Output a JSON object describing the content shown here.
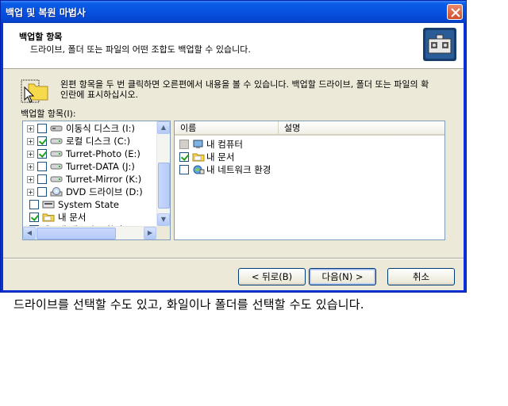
{
  "window": {
    "title": "백업 및 복원 마법사"
  },
  "header": {
    "title": "백업할 항목",
    "subtitle": "드라이브, 폴더 또는 파일의 어떤 조합도 백업할 수 있습니다."
  },
  "intro": {
    "text": "왼편 항목을 두 번 클릭하면 오른편에서 내용을 볼 수 있습니다. 백업할 드라이브, 폴더 또는 파일의 확인란에 표시하십시오."
  },
  "items_label": "백업할 항목(I):",
  "tree": [
    {
      "label": "이동식 디스크 (I:)",
      "icon": "removable-drive-icon",
      "checked": false,
      "expander": "+"
    },
    {
      "label": "로컬 디스크 (C:)",
      "icon": "hard-drive-icon",
      "checked": true,
      "expander": "+"
    },
    {
      "label": "Turret-Photo (E:)",
      "icon": "hard-drive-icon",
      "checked": true,
      "expander": "+"
    },
    {
      "label": "Turret-DATA (J:)",
      "icon": "hard-drive-icon",
      "checked": false,
      "expander": "+"
    },
    {
      "label": "Turret-Mirror (K:)",
      "icon": "hard-drive-icon",
      "checked": false,
      "expander": "+"
    },
    {
      "label": "DVD 드라이브 (D:)",
      "icon": "dvd-drive-icon",
      "checked": false,
      "expander": "+"
    },
    {
      "label": "System State",
      "icon": "system-state-icon",
      "checked": false,
      "expander": ""
    },
    {
      "label": "내 문서",
      "icon": "folder-icon",
      "checked": true,
      "expander": ""
    },
    {
      "label": "내 네트워크 환경",
      "icon": "network-icon",
      "checked": false,
      "expander": ""
    }
  ],
  "list": {
    "columns": [
      "이름",
      "설명"
    ],
    "rows": [
      {
        "name": "내 컴퓨터",
        "icon": "computer-icon",
        "checked": "partial"
      },
      {
        "name": "내 문서",
        "icon": "folder-icon",
        "checked": true
      },
      {
        "name": "내 네트워크 환경",
        "icon": "network-icon",
        "checked": false
      }
    ]
  },
  "buttons": {
    "back": "< 뒤로(B)",
    "next": "다음(N) >",
    "cancel": "취소"
  },
  "caption": "드라이브를 선택할 수도 있고, 화일이나 폴더를 선택할 수도 있습니다.",
  "colors": {
    "titlebar": "#0a5ce6",
    "dialog_bg": "#ece9d8",
    "check_green": "#21a121"
  }
}
